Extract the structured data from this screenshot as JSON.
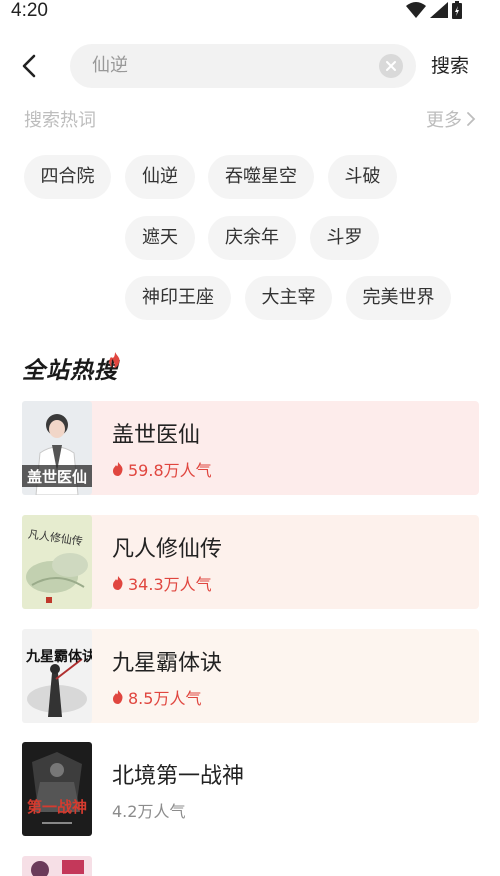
{
  "status": {
    "time": "4:20"
  },
  "search": {
    "query": "仙逆",
    "button_label": "搜索"
  },
  "hot": {
    "title": "搜索热词",
    "more_label": "更多"
  },
  "tags": [
    "四合院",
    "仙逆",
    "吞噬星空",
    "斗破",
    "遮天",
    "庆余年",
    "斗罗",
    "神印王座",
    "大主宰",
    "完美世界"
  ],
  "section": {
    "title": "全站热搜"
  },
  "books": [
    {
      "title": "盖世医仙",
      "popularity": "59.8万人气",
      "hot": true
    },
    {
      "title": "凡人修仙传",
      "popularity": "34.3万人气",
      "hot": true
    },
    {
      "title": "九星霸体诀",
      "popularity": "8.5万人气",
      "hot": true
    },
    {
      "title": "北境第一战神",
      "popularity": "4.2万人气",
      "hot": false
    }
  ],
  "colors": {
    "accent": "#e0463f",
    "card1": "#fdeceb",
    "card2": "#fdf1ec",
    "card3": "#fdf5ef",
    "tag_bg": "#f4f4f4"
  }
}
